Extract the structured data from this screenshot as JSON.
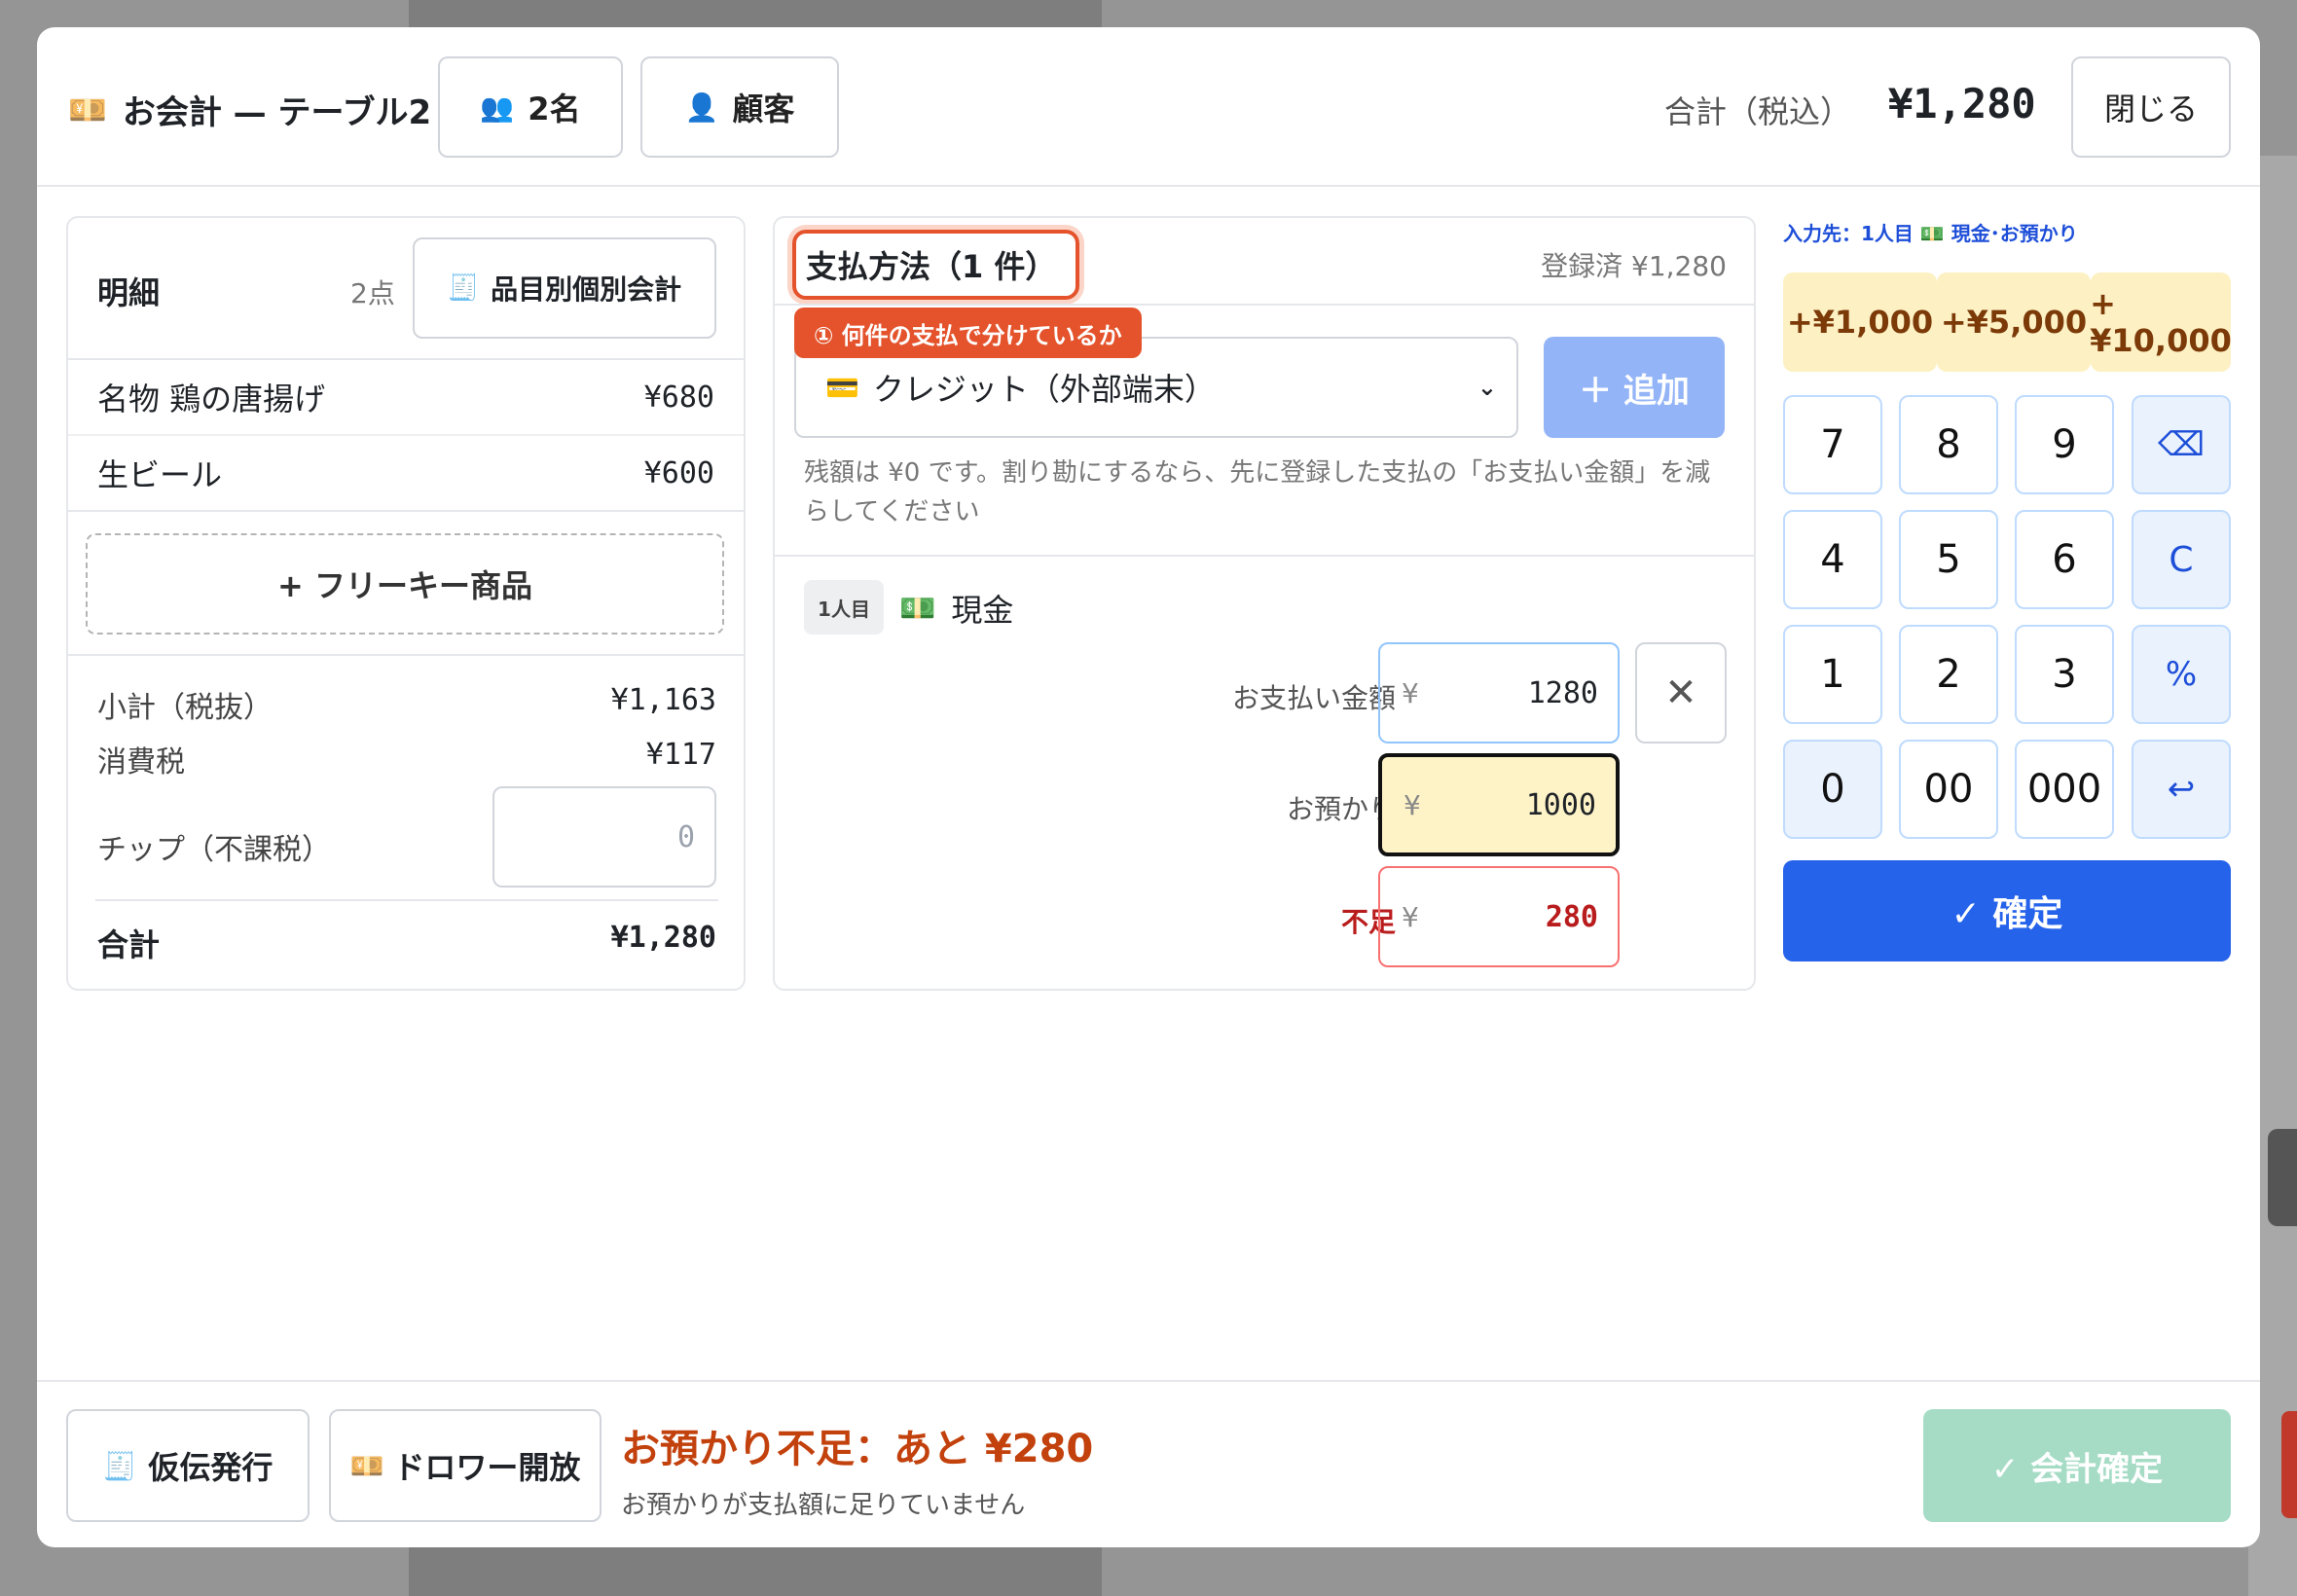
{
  "header": {
    "title": "お会計 — テーブル2",
    "guests_label": "2名",
    "customer_label": "顧客",
    "total_label": "合計（税込）",
    "total_value": "¥1,280",
    "close_label": "閉じる"
  },
  "items_panel": {
    "title": "明細",
    "count": "2点",
    "split_by_item_label": "品目別個別会計",
    "items": [
      {
        "name": "名物 鶏の唐揚げ",
        "price": "¥680"
      },
      {
        "name": "生ビール",
        "price": "¥600"
      }
    ],
    "free_key_label": "+ フリーキー商品",
    "subtotal_label": "小計（税抜）",
    "subtotal_value": "¥1,163",
    "tax_label": "消費税",
    "tax_value": "¥117",
    "tip_label": "チップ（不課税）",
    "tip_placeholder": "0",
    "total_label": "合計",
    "total_value": "¥1,280"
  },
  "payment_panel": {
    "title": "支払方法（1 件）",
    "registered": "登録済 ¥1,280",
    "tooltip": "① 何件の支払で分けているか",
    "method_selected": "クレジット（外部端末）",
    "add_label": "＋ 追加",
    "note": "残額は ¥0 です。割り勘にするなら、先に登録した支払の「お支払い金額」を減らしてください",
    "entry": {
      "person_badge": "1人目",
      "method": "現金",
      "pay_amount_label": "お支払い金額",
      "pay_amount_value": "1280",
      "deposit_label": "お預かり",
      "deposit_value": "1000",
      "shortage_label": "不足",
      "shortage_value": "280",
      "currency": "¥"
    }
  },
  "keypad": {
    "target": "入力先：1人目 💵 現金･お預かり",
    "quick": [
      "+¥1,000",
      "+¥5,000",
      "+¥10,000"
    ],
    "keys": [
      "7",
      "8",
      "9",
      "⌫",
      "4",
      "5",
      "6",
      "C",
      "1",
      "2",
      "3",
      "%",
      "0",
      "00",
      "000",
      "↩"
    ],
    "confirm_label": "✓ 確定"
  },
  "footer": {
    "provisional_label": "仮伝発行",
    "drawer_label": "ドロワー開放",
    "warning_title": "お預かり不足：あと ¥280",
    "warning_sub": "お預かりが支払額に足りていません",
    "finalize_label": "✓ 会計確定"
  },
  "colors": {
    "accent_blue": "#2563eb",
    "warning_orange": "#c2410c",
    "error_red": "#dc2626",
    "tooltip_bg": "#e4532c",
    "finalize_disabled": "#a6dcc6",
    "quick_bg": "#fdf1c4"
  }
}
